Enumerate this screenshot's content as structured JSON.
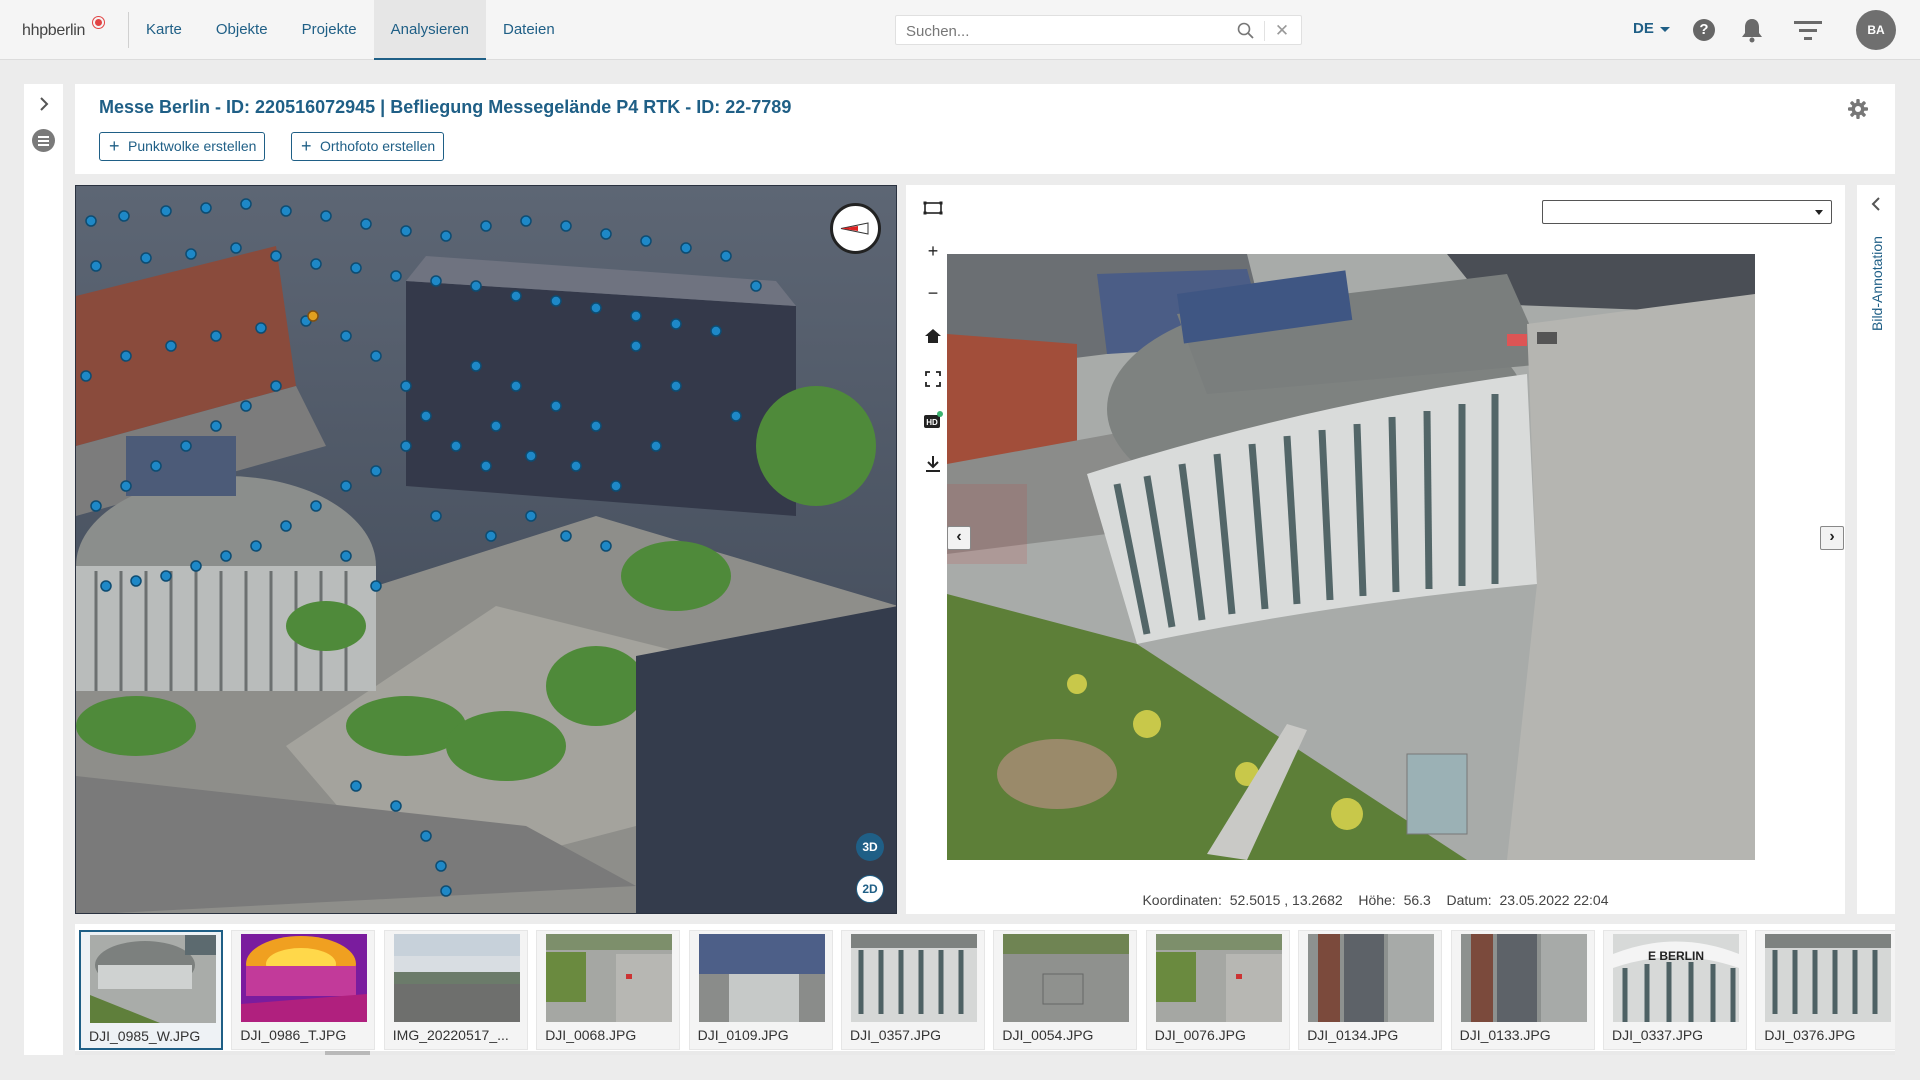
{
  "app": {
    "logo_text": "hhpberlin"
  },
  "nav": {
    "items": [
      {
        "label": "Karte"
      },
      {
        "label": "Objekte"
      },
      {
        "label": "Projekte"
      },
      {
        "label": "Analysieren",
        "active": true
      },
      {
        "label": "Dateien"
      }
    ]
  },
  "search": {
    "placeholder": "Suchen...",
    "value": ""
  },
  "user": {
    "language": "DE",
    "initials": "BA"
  },
  "header": {
    "title": "Messe Berlin - ID: 220516072945 | Befliegung Messegelände P4 RTK - ID: 22-7789",
    "buttons": [
      {
        "label": "Punktwolke erstellen"
      },
      {
        "label": "Orthofoto erstellen"
      }
    ]
  },
  "viewer": {
    "mode_3d_label": "3D",
    "mode_2d_label": "2D",
    "hd_label": "HD"
  },
  "image_panel": {
    "dropdown_value": "",
    "coords_label": "Koordinaten:",
    "coords_value": "52.5015 , 13.2682",
    "height_label": "Höhe:",
    "height_value": "56.3",
    "date_label": "Datum:",
    "date_value": "23.05.2022 22:04"
  },
  "annotation": {
    "label": "Bild-Annotation"
  },
  "thumbnails": [
    {
      "name": "DJI_0985_W.JPG",
      "selected": true,
      "kind": "aerial"
    },
    {
      "name": "DJI_0986_T.JPG",
      "kind": "thermal"
    },
    {
      "name": "IMG_20220517_...",
      "kind": "ground"
    },
    {
      "name": "DJI_0068.JPG",
      "kind": "roof"
    },
    {
      "name": "DJI_0109.JPG",
      "kind": "solar"
    },
    {
      "name": "DJI_0357.JPG",
      "kind": "facade"
    },
    {
      "name": "DJI_0054.JPG",
      "kind": "plaza"
    },
    {
      "name": "DJI_0076.JPG",
      "kind": "roof"
    },
    {
      "name": "DJI_0134.JPG",
      "kind": "road"
    },
    {
      "name": "DJI_0133.JPG",
      "kind": "road"
    },
    {
      "name": "DJI_0337.JPG",
      "kind": "berlin",
      "sign": "E BERLIN"
    },
    {
      "name": "DJI_0376.JPG",
      "kind": "facade"
    }
  ],
  "colors": {
    "accent": "#1f5f86",
    "camera_point": "#1e88c7",
    "thermal": "#e0801a"
  }
}
